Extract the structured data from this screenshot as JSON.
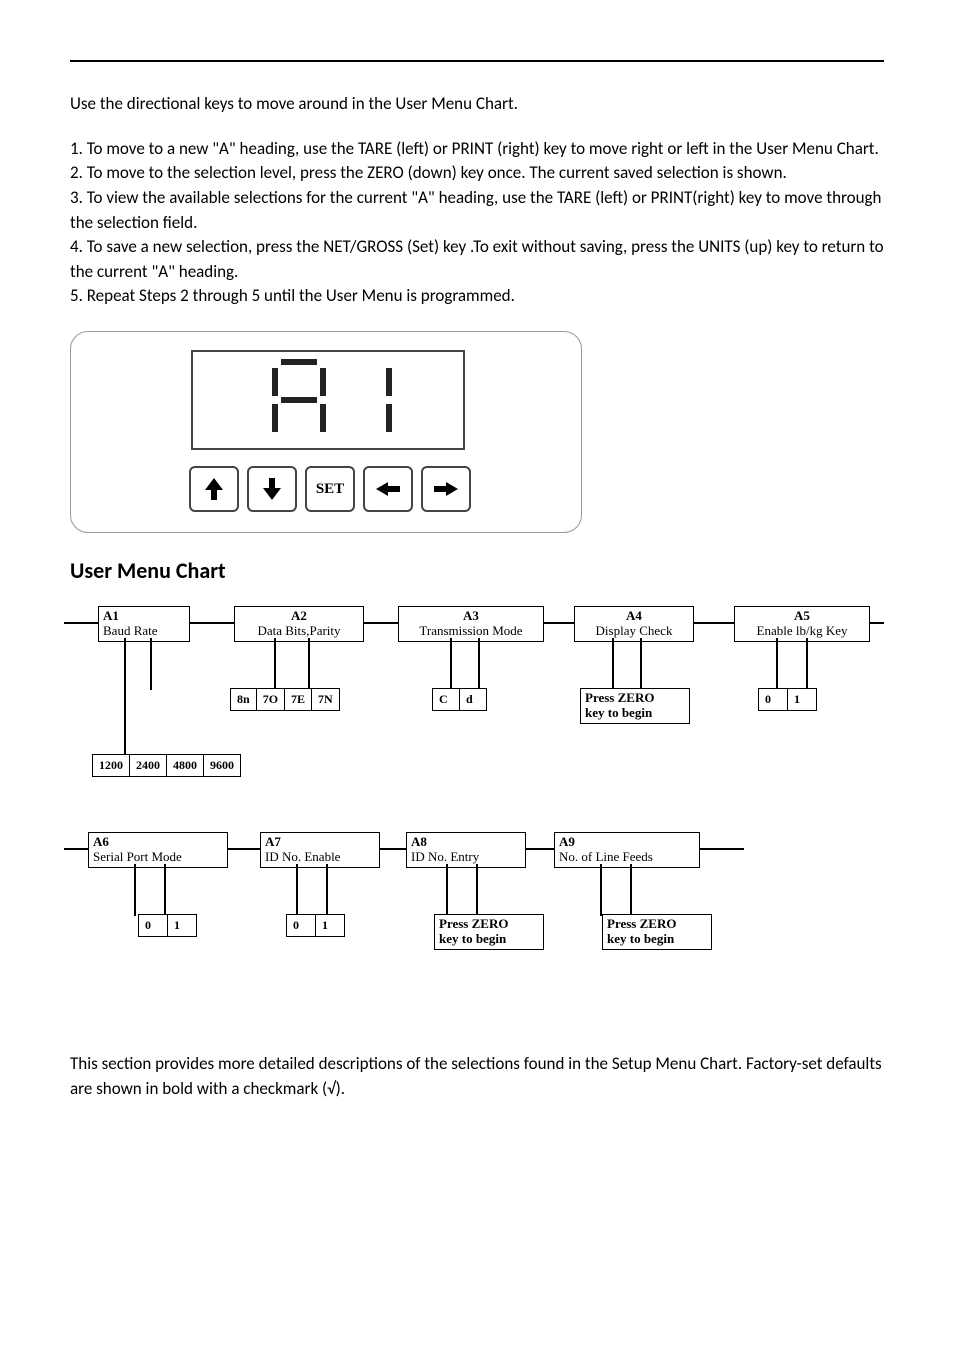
{
  "intro": "Use the directional keys to move around in the User Menu Chart.",
  "steps": {
    "s1": "1. To move to a new \"A\" heading, use the TARE (left) or PRINT (right) key to move right or left in the User Menu Chart.",
    "s2": "2. To move to the selection level, press the ZERO (down) key once. The current saved selection is shown.",
    "s3": "3. To view the available selections for the current \"A\" heading, use the TARE (left) or PRINT(right) key to move through the selection field.",
    "s4": "4. To save a new selection, press the NET/GROSS (Set) key .To exit without saving, press the UNITS (up) key to return to the current \"A\" heading.",
    "s5": "5. Repeat Steps 2 through 5 until the User Menu is programmed."
  },
  "set_label": "SET",
  "section_title": "User Menu Chart",
  "chart": {
    "a1": {
      "code": "A1",
      "label": "Baud Rate",
      "opts": [
        "1200",
        "2400",
        "4800",
        "9600"
      ]
    },
    "a2": {
      "code": "A2",
      "label": "Data Bits,Parity",
      "opts": [
        "8n",
        "7O",
        "7E",
        "7N"
      ]
    },
    "a3": {
      "code": "A3",
      "label": "Transmission Mode",
      "opts": [
        "C",
        "d"
      ]
    },
    "a4": {
      "code": "A4",
      "label": "Display Check",
      "opts_text": "Press ZERO\nkey to begin"
    },
    "a5": {
      "code": "A5",
      "label": "Enable lb/kg Key",
      "opts": [
        "0",
        "1"
      ]
    },
    "a6": {
      "code": "A6",
      "label": "Serial Port Mode",
      "opts": [
        "0",
        "1"
      ]
    },
    "a7": {
      "code": "A7",
      "label": "ID No. Enable",
      "opts": [
        "0",
        "1"
      ]
    },
    "a8": {
      "code": "A8",
      "label": "ID No. Entry",
      "opts_text": "Press ZERO\nkey to begin"
    },
    "a9": {
      "code": "A9",
      "label": "No. of Line Feeds",
      "opts_text": "Press ZERO\nkey to begin"
    }
  },
  "closing": "This section provides more detailed descriptions of the selections found in the Setup Menu Chart. Factory-set defaults are shown in bold with a checkmark (√)."
}
